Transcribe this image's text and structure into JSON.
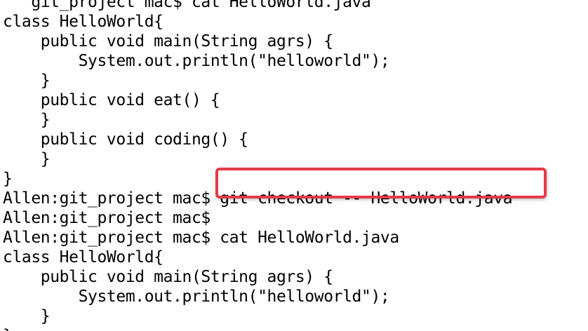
{
  "terminal": {
    "lines": [
      "   git_project mac$ cat HelloWorld.java",
      "class HelloWorld{",
      "    public void main(String agrs) {",
      "        System.out.println(\"helloworld\");",
      "    }",
      "    public void eat() {",
      "    }",
      "    public void coding() {",
      "    }",
      "}",
      "Allen:git_project mac$ git checkout -- HelloWorld.java",
      "Allen:git_project mac$",
      "Allen:git_project mac$ cat HelloWorld.java",
      "class HelloWorld{",
      "    public void main(String agrs) {",
      "        System.out.println(\"helloworld\");",
      "    }",
      "}"
    ]
  },
  "annotation": {
    "color": "#e53a45",
    "highlighted_command": "git checkout -- HelloWorld.java"
  }
}
